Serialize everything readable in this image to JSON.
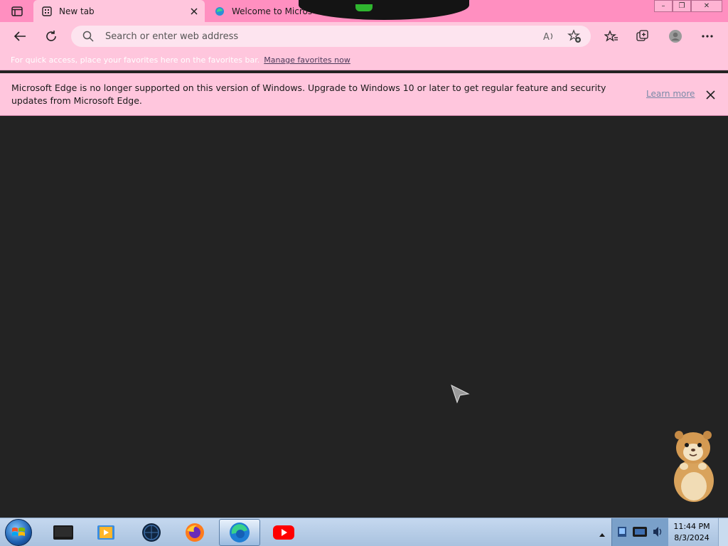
{
  "browser": {
    "tabs": [
      {
        "title": "New tab",
        "active": true
      },
      {
        "title": "Welcome to Microso",
        "active": false
      }
    ],
    "window_controls": {
      "minimize": "–",
      "maximize": "❐",
      "close": "✕"
    }
  },
  "address_bar": {
    "placeholder": "Search or enter web address",
    "value": ""
  },
  "favorites_bar": {
    "message": "For quick access, place your favorites here on the favorites bar.",
    "link": "Manage favorites now"
  },
  "info_bar": {
    "message": "Microsoft Edge is no longer supported on this version of Windows. Upgrade to Windows 10 or later to get regular feature and security updates from Microsoft Edge.",
    "learn_more": "Learn more"
  },
  "taskbar": {
    "items": [
      {
        "icon": "media-center-icon"
      },
      {
        "icon": "media-player-icon"
      },
      {
        "icon": "globe-app-icon"
      },
      {
        "icon": "firefox-icon"
      },
      {
        "icon": "edge-icon",
        "active": true
      },
      {
        "icon": "youtube-icon"
      }
    ],
    "clock": {
      "time": "11:44 PM",
      "date": "8/3/2024"
    }
  },
  "colors": {
    "titlebar": "#ff8fc0",
    "toolbar": "#ffc6dd",
    "content_bg": "#232323"
  }
}
